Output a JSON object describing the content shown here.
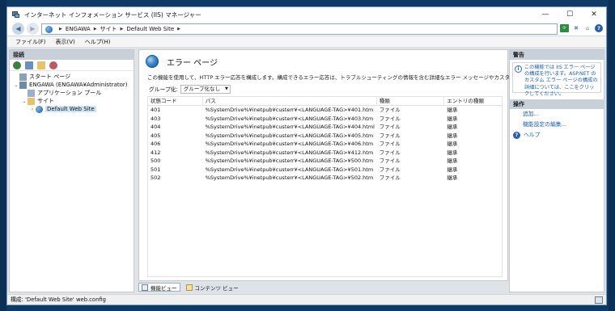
{
  "window": {
    "title": "インターネット インフォメーション サービス (IIS) マネージャー",
    "controls": {
      "minimize": "—",
      "maximize": "☐",
      "close": "✕"
    }
  },
  "address": {
    "breadcrumbs": [
      "ENGAWA",
      "サイト",
      "Default Web Site"
    ],
    "separator": "▶"
  },
  "menu": {
    "items": [
      "ファイル(F)",
      "表示(V)",
      "ヘルプ(H)"
    ]
  },
  "left_pane": {
    "header": "接続",
    "tree": [
      {
        "label": "スタート ページ",
        "toggle": "",
        "icon": "start-page-icon"
      },
      {
        "label": "ENGAWA (ENGAWA¥Administrator)",
        "toggle": "⌄",
        "icon": "server-icon"
      },
      {
        "label": "アプリケーション プール",
        "toggle": "",
        "icon": "app-pool-icon"
      },
      {
        "label": "サイト",
        "toggle": "⌄",
        "icon": "sites-folder-icon"
      },
      {
        "label": "Default Web Site",
        "toggle": "›",
        "icon": "website-globe-icon"
      }
    ]
  },
  "center": {
    "title": "エラー ページ",
    "description": "この機能を使用して、HTTP エラー応答を構成します。構成できるエラー応答は、トラブルシューティングの情報を含む詳細なエラー メッセージやカスタム エラー ページです。",
    "group_by_label": "グループ化:",
    "group_by_value": "グループ化なし",
    "table": {
      "headers": [
        "状態コード",
        "パス",
        "種類",
        "エントリの種類"
      ],
      "rows": [
        [
          "401",
          "%SystemDrive%¥inetpub¥custerr¥<LANGUAGE-TAG>¥401.htm",
          "ファイル",
          "継承"
        ],
        [
          "403",
          "%SystemDrive%¥inetpub¥custerr¥<LANGUAGE-TAG>¥403.htm",
          "ファイル",
          "継承"
        ],
        [
          "404",
          "%SystemDrive%¥inetpub¥custerr¥<LANGUAGE-TAG>¥404.html",
          "ファイル",
          "継承"
        ],
        [
          "405",
          "%SystemDrive%¥inetpub¥custerr¥<LANGUAGE-TAG>¥405.htm",
          "ファイル",
          "継承"
        ],
        [
          "406",
          "%SystemDrive%¥inetpub¥custerr¥<LANGUAGE-TAG>¥406.htm",
          "ファイル",
          "継承"
        ],
        [
          "412",
          "%SystemDrive%¥inetpub¥custerr¥<LANGUAGE-TAG>¥412.htm",
          "ファイル",
          "継承"
        ],
        [
          "500",
          "%SystemDrive%¥inetpub¥custerr¥<LANGUAGE-TAG>¥500.htm",
          "ファイル",
          "継承"
        ],
        [
          "501",
          "%SystemDrive%¥inetpub¥custerr¥<LANGUAGE-TAG>¥501.htm",
          "ファイル",
          "継承"
        ],
        [
          "502",
          "%SystemDrive%¥inetpub¥custerr¥<LANGUAGE-TAG>¥502.htm",
          "ファイル",
          "継承"
        ]
      ]
    },
    "tabs": [
      "機能ビュー",
      "コンテンツ ビュー"
    ]
  },
  "right_pane": {
    "alerts_header": "警告",
    "alert_text": "この機能では IIS エラー ページの構成を行います。ASP.NET のカスタム エラー ページの構成の詳細については、ここをクリックしてください。",
    "actions_header": "操作",
    "actions": [
      "追加...",
      "機能設定の編集..."
    ],
    "help": "ヘルプ"
  },
  "statusbar": {
    "text": "構成: 'Default Web Site' web.config"
  },
  "colors": {
    "link": "#1f5fa8",
    "pane_header": "#c8d0da",
    "selection": "#cce4f7"
  }
}
